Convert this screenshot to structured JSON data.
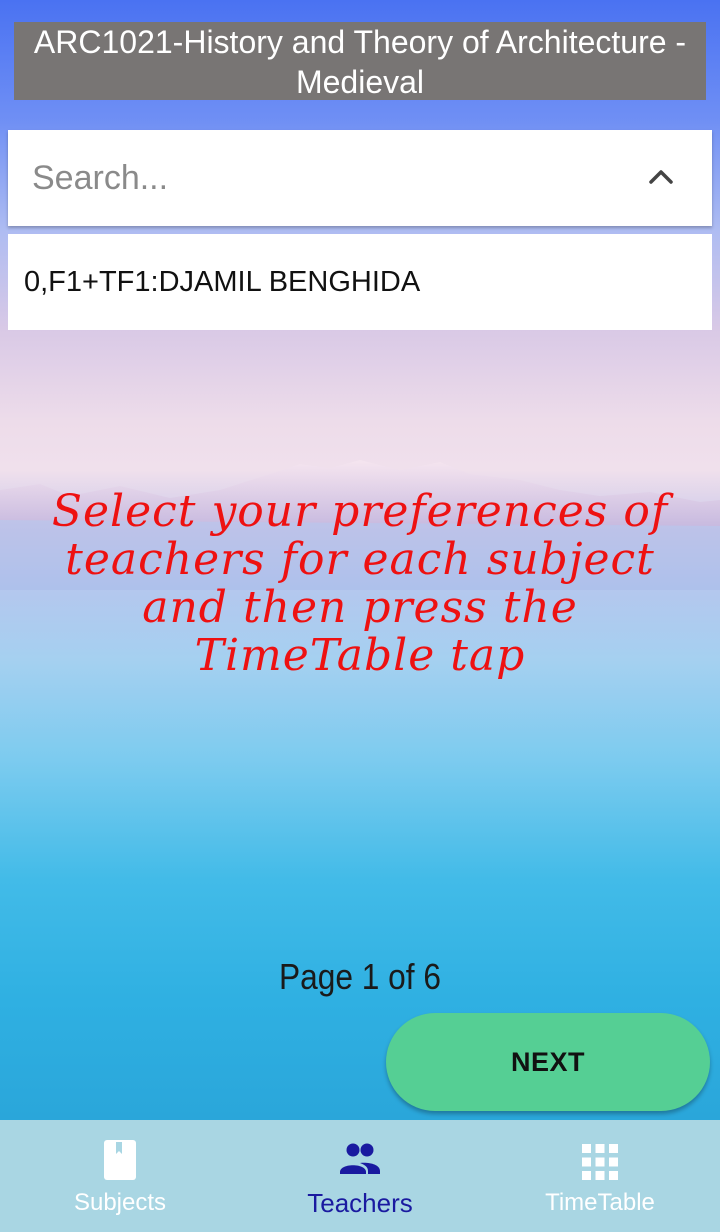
{
  "header": {
    "title": "ARC1021-History and Theory of Architecture - Medieval"
  },
  "search": {
    "placeholder": "Search...",
    "toggle_icon": "chevron-up-icon"
  },
  "results": [
    {
      "label": "0,F1+TF1:DJAMIL BENGHIDA"
    }
  ],
  "hint": {
    "text": "Select your preferences of teachers for each subject and then press the TimeTable tap",
    "color": "#ee1111"
  },
  "pagination": {
    "text": "Page 1 of 6"
  },
  "next_button": {
    "label": "NEXT",
    "color": "#55cf94"
  },
  "bottom_nav": {
    "items": [
      {
        "label": "Subjects",
        "icon": "book-icon",
        "active": false
      },
      {
        "label": "Teachers",
        "icon": "people-icon",
        "active": true
      },
      {
        "label": "TimeTable",
        "icon": "grid-icon",
        "active": false
      }
    ],
    "background": "#a9d6e3",
    "active_color": "#1a1aa0"
  }
}
